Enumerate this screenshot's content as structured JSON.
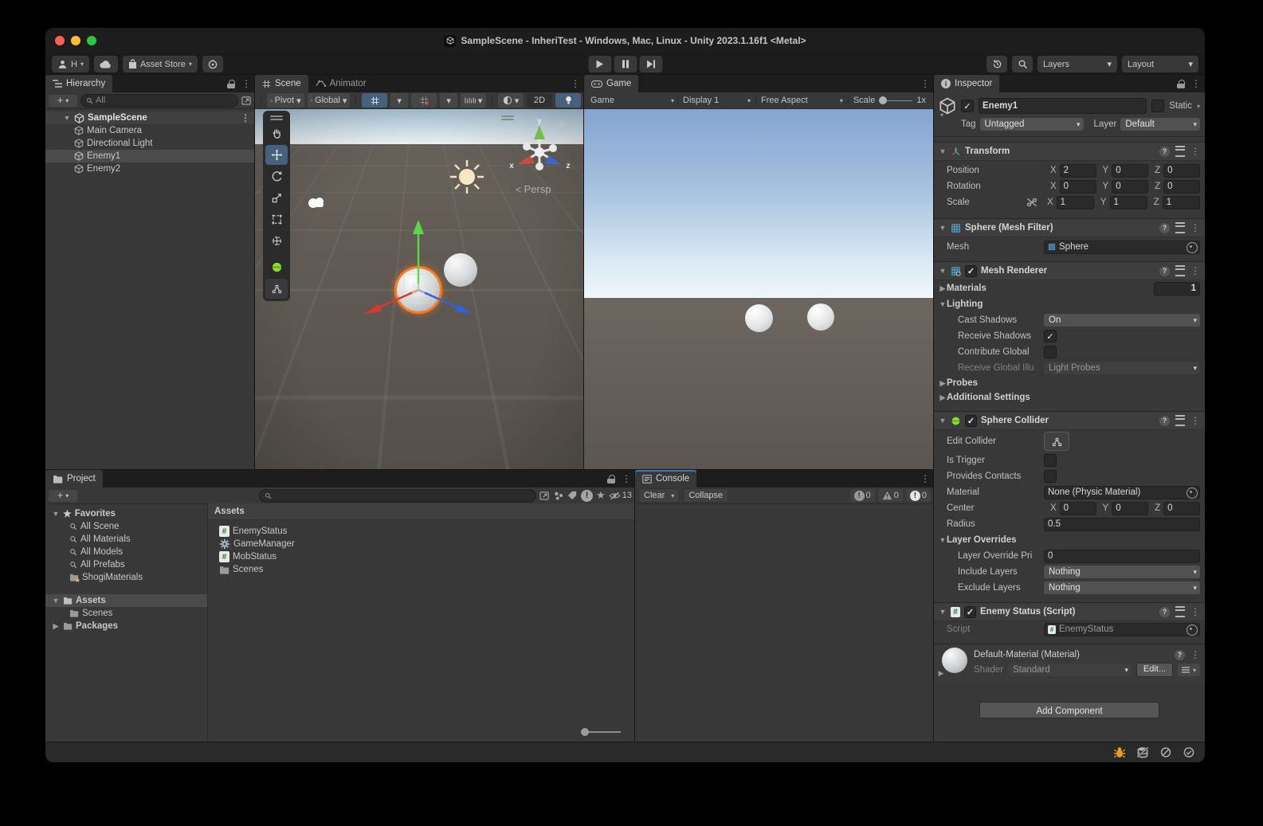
{
  "window": {
    "title": "SampleScene - InheriTest - Windows, Mac, Linux - Unity 2023.1.16f1 <Metal>"
  },
  "toolbar": {
    "account": "H",
    "asset_store": "Asset Store",
    "layers": "Layers",
    "layout": "Layout"
  },
  "hierarchy": {
    "tab": "Hierarchy",
    "search": "All",
    "scene_name": "SampleScene",
    "items": [
      "Main Camera",
      "Directional Light",
      "Enemy1",
      "Enemy2"
    ]
  },
  "scene": {
    "tab_scene": "Scene",
    "tab_animator": "Animator",
    "pivot": "Pivot",
    "handle_space": "Global",
    "two_d": "2D",
    "persp": "Persp",
    "axis_x": "x",
    "axis_y": "y",
    "axis_z": "z"
  },
  "game": {
    "tab": "Game",
    "mode": "Game",
    "display": "Display 1",
    "aspect": "Free Aspect",
    "scale_label": "Scale",
    "scale_value": "1x"
  },
  "project": {
    "tab": "Project",
    "favorites": "Favorites",
    "favorite_items": [
      "All Scene",
      "All Materials",
      "All Models",
      "All Prefabs",
      "ShogiMaterials"
    ],
    "assets_folder": "Assets",
    "scenes_folder": "Scenes",
    "packages": "Packages",
    "assets_header": "Assets",
    "assets": [
      "EnemyStatus",
      "GameManager",
      "MobStatus",
      "Scenes"
    ],
    "hidden_count": "13"
  },
  "console": {
    "tab": "Console",
    "clear": "Clear",
    "collapse": "Collapse",
    "info_count": "0",
    "warning_count": "0",
    "error_count": "0"
  },
  "inspector": {
    "tab": "Inspector",
    "name": "Enemy1",
    "static_label": "Static",
    "tag_label": "Tag",
    "tag_value": "Untagged",
    "layer_label": "Layer",
    "layer_value": "Default",
    "axes": {
      "x": "X",
      "y": "Y",
      "z": "Z"
    },
    "transform": {
      "title": "Transform",
      "rows": [
        {
          "label": "Position",
          "x": "2",
          "y": "0",
          "z": "0"
        },
        {
          "label": "Rotation",
          "x": "0",
          "y": "0",
          "z": "0"
        },
        {
          "label": "Scale",
          "x": "1",
          "y": "1",
          "z": "1"
        }
      ]
    },
    "mesh_filter": {
      "title": "Sphere (Mesh Filter)",
      "mesh_label": "Mesh",
      "mesh_value": "Sphere"
    },
    "mesh_renderer": {
      "title": "Mesh Renderer",
      "materials_label": "Materials",
      "materials_count": "1",
      "lighting_label": "Lighting",
      "cast_shadows_label": "Cast Shadows",
      "cast_shadows_value": "On",
      "receive_shadows_label": "Receive Shadows",
      "contribute_gi_label": "Contribute Global",
      "receive_gi_label": "Receive Global Illu",
      "receive_gi_value": "Light Probes",
      "probes_label": "Probes",
      "additional_label": "Additional Settings"
    },
    "sphere_collider": {
      "title": "Sphere Collider",
      "edit_collider_label": "Edit Collider",
      "is_trigger_label": "Is Trigger",
      "provides_contacts_label": "Provides Contacts",
      "material_label": "Material",
      "material_value": "None (Physic Material)",
      "center_label": "Center",
      "center": {
        "x": "0",
        "y": "0",
        "z": "0"
      },
      "radius_label": "Radius",
      "radius_value": "0.5",
      "layer_overrides_label": "Layer Overrides",
      "priority_label": "Layer Override Pri",
      "priority_value": "0",
      "include_label": "Include Layers",
      "include_value": "Nothing",
      "exclude_label": "Exclude Layers",
      "exclude_value": "Nothing"
    },
    "enemy_status": {
      "title": "Enemy Status (Script)",
      "script_label": "Script",
      "script_value": "EnemyStatus"
    },
    "material": {
      "title": "Default-Material (Material)",
      "shader_label": "Shader",
      "shader_value": "Standard",
      "edit_button": "Edit..."
    },
    "add_component": "Add Component"
  },
  "colors": {
    "accent_selection": "#46607e",
    "traffic_red": "#ff5f57",
    "traffic_yellow": "#febc2e",
    "traffic_green": "#28c840",
    "console_tab_accent": "#3a79bb",
    "gizmo_orange": "#ff7a1a"
  }
}
